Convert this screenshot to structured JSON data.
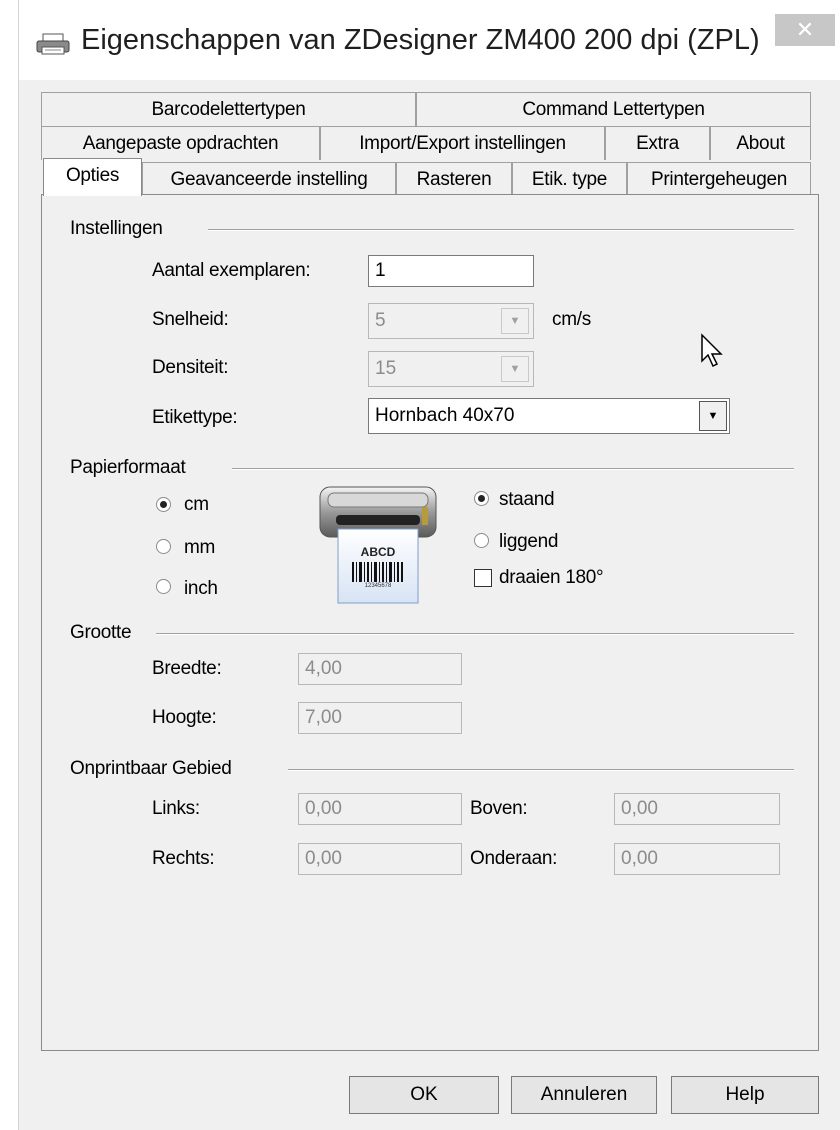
{
  "window": {
    "title": "Eigenschappen van ZDesigner ZM400 200 dpi (ZPL)",
    "close_glyph": "✕"
  },
  "tabs": {
    "row1": [
      "Barcodelettertypen",
      "Command Lettertypen"
    ],
    "row2": [
      "Aangepaste opdrachten",
      "Import/Export instellingen",
      "Extra",
      "About"
    ],
    "row3": [
      "Opties",
      "Geavanceerde instelling",
      "Rasteren",
      "Etik. type",
      "Printergeheugen"
    ],
    "active": "Opties"
  },
  "instellingen": {
    "group_label": "Instellingen",
    "copies_label": "Aantal exemplaren:",
    "copies_value": "1",
    "speed_label": "Snelheid:",
    "speed_value": "5",
    "speed_unit": "cm/s",
    "density_label": "Densiteit:",
    "density_value": "15",
    "labeltype_label": "Etikettype:",
    "labeltype_value": "Hornbach 40x70"
  },
  "papierformaat": {
    "group_label": "Papierformaat",
    "units": [
      "cm",
      "mm",
      "inch"
    ],
    "selected_unit": "cm",
    "orientation": [
      "staand",
      "liggend"
    ],
    "selected_orientation": "staand",
    "rotate_label": "draaien 180°",
    "rotate_checked": false,
    "preview_text": "ABCD",
    "preview_barcode_number": "12345678"
  },
  "grootte": {
    "group_label": "Grootte",
    "width_label": "Breedte:",
    "width_value": "4,00",
    "height_label": "Hoogte:",
    "height_value": "7,00"
  },
  "onprintbaar": {
    "group_label": "Onprintbaar Gebied",
    "left_label": "Links:",
    "left_value": "0,00",
    "top_label": "Boven:",
    "top_value": "0,00",
    "right_label": "Rechts:",
    "right_value": "0,00",
    "bottom_label": "Onderaan:",
    "bottom_value": "0,00"
  },
  "buttons": {
    "ok": "OK",
    "cancel": "Annuleren",
    "help": "Help"
  }
}
